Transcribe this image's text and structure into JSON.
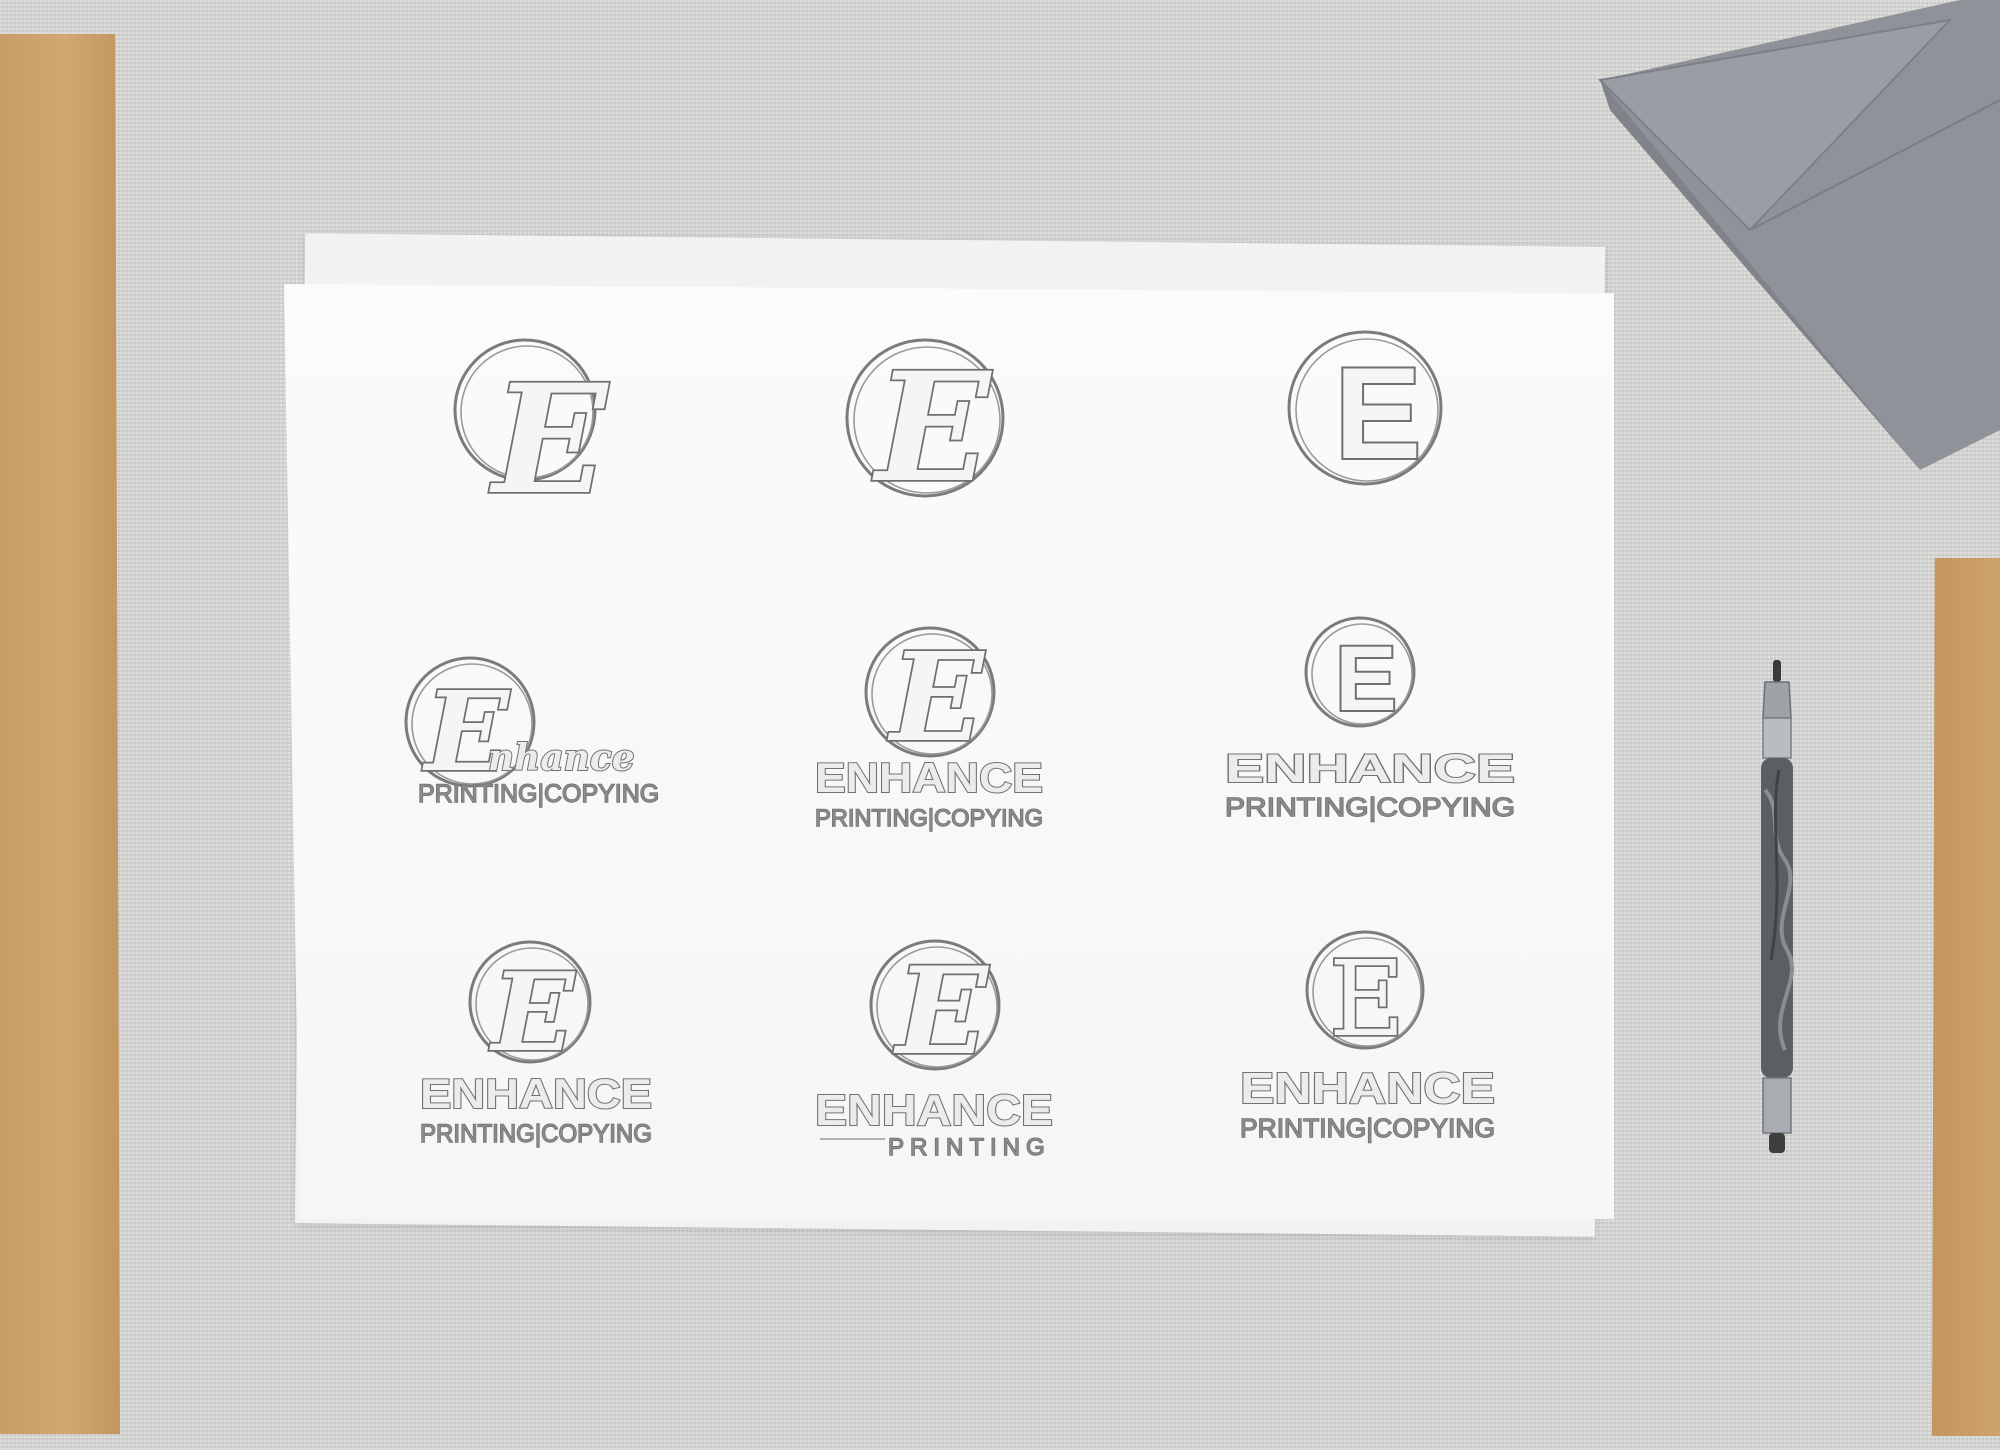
{
  "scene": {
    "objects": [
      "kraft paper sheet",
      "gray envelope",
      "white paper sheet",
      "clutch pencil"
    ],
    "colors": {
      "surface": "#d7d7d5",
      "kraft": "#cca26d",
      "envelope": "#8f9298",
      "paper": "#f8f8f8",
      "sketch": "#7b7b7b",
      "pencil": "#5b5f63"
    }
  },
  "sheet": {
    "letter": "E",
    "brand_title": "ENHANCE",
    "brand_script": "nhance",
    "sub_full": "PRINTING|COPYING",
    "sub_short": "PRINTING"
  }
}
